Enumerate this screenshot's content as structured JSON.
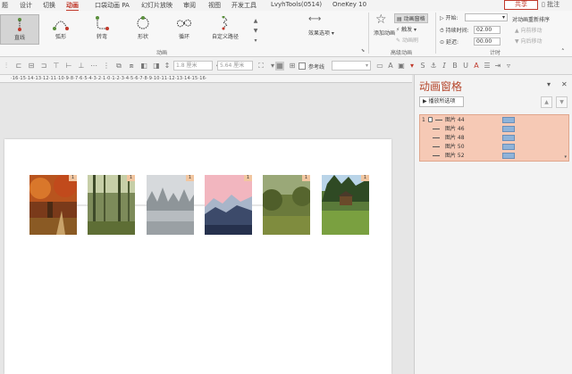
{
  "tabs": [
    {
      "label": "题",
      "active": false
    },
    {
      "label": "设计",
      "active": false
    },
    {
      "label": "切换",
      "active": false
    },
    {
      "label": "动画",
      "active": true
    },
    {
      "label": "口袋动画 PA",
      "active": false
    },
    {
      "label": "幻灯片放映",
      "active": false
    },
    {
      "label": "审阅",
      "active": false
    },
    {
      "label": "视图",
      "active": false
    },
    {
      "label": "开发工具",
      "active": false
    },
    {
      "label": "LvyhTools(0514)",
      "active": false
    },
    {
      "label": "OneKey 10",
      "active": false
    }
  ],
  "share_label": "共享",
  "comment_label": "批注",
  "gallery": [
    {
      "label": "直线",
      "icon": "line-path-icon",
      "selected": true
    },
    {
      "label": "弧形",
      "icon": "arc-path-icon",
      "selected": false
    },
    {
      "label": "转弯",
      "icon": "turn-path-icon",
      "selected": false
    },
    {
      "label": "形状",
      "icon": "shape-path-icon",
      "selected": false
    },
    {
      "label": "循环",
      "icon": "loop-path-icon",
      "selected": false
    },
    {
      "label": "自定义路径",
      "icon": "custom-path-icon",
      "selected": false
    }
  ],
  "effect_options_label": "效果选项",
  "group_animation_label": "动画",
  "add_animation_label": "添加动画",
  "animation_pane_btn_label": "动画窗格",
  "trigger_label": "触发",
  "animation_painter_label": "动画刷",
  "group_advanced_label": "高级动画",
  "timing": {
    "start_label": "开始:",
    "start_value": "",
    "duration_label": "持续时间:",
    "duration_value": "02.00",
    "delay_label": "延迟:",
    "delay_value": "00.00",
    "reorder_label": "对动画重新排序",
    "move_earlier_label": "向前移动",
    "move_later_label": "向后移动",
    "group_label": "计时"
  },
  "toolbar2": {
    "height_value": "1.8 厘米",
    "width_value": "5.64 厘米",
    "guides_label": "参考线"
  },
  "ruler_text": "·16·15·14·13·12·11·10·9·8·7·6·5·4·3·2·1·0·1·2·3·4·5·6·7·8·9·10·11·12·13·14·15·16·",
  "pane": {
    "title": "动画窗格",
    "play_label": "播放所选项",
    "rows": [
      {
        "num": "1",
        "name": "图片 44"
      },
      {
        "num": "",
        "name": "图片 46"
      },
      {
        "num": "",
        "name": "图片 48"
      },
      {
        "num": "",
        "name": "图片 50"
      },
      {
        "num": "",
        "name": "图片 52"
      }
    ]
  },
  "slide_badges": [
    "1",
    "1",
    "1",
    "1",
    "1",
    "1"
  ],
  "colors": {
    "accent": "#c0392b",
    "pane_title": "#b5462b",
    "pane_list_bg": "#f6c9b5",
    "timeline_bar": "#8fb3d9"
  }
}
